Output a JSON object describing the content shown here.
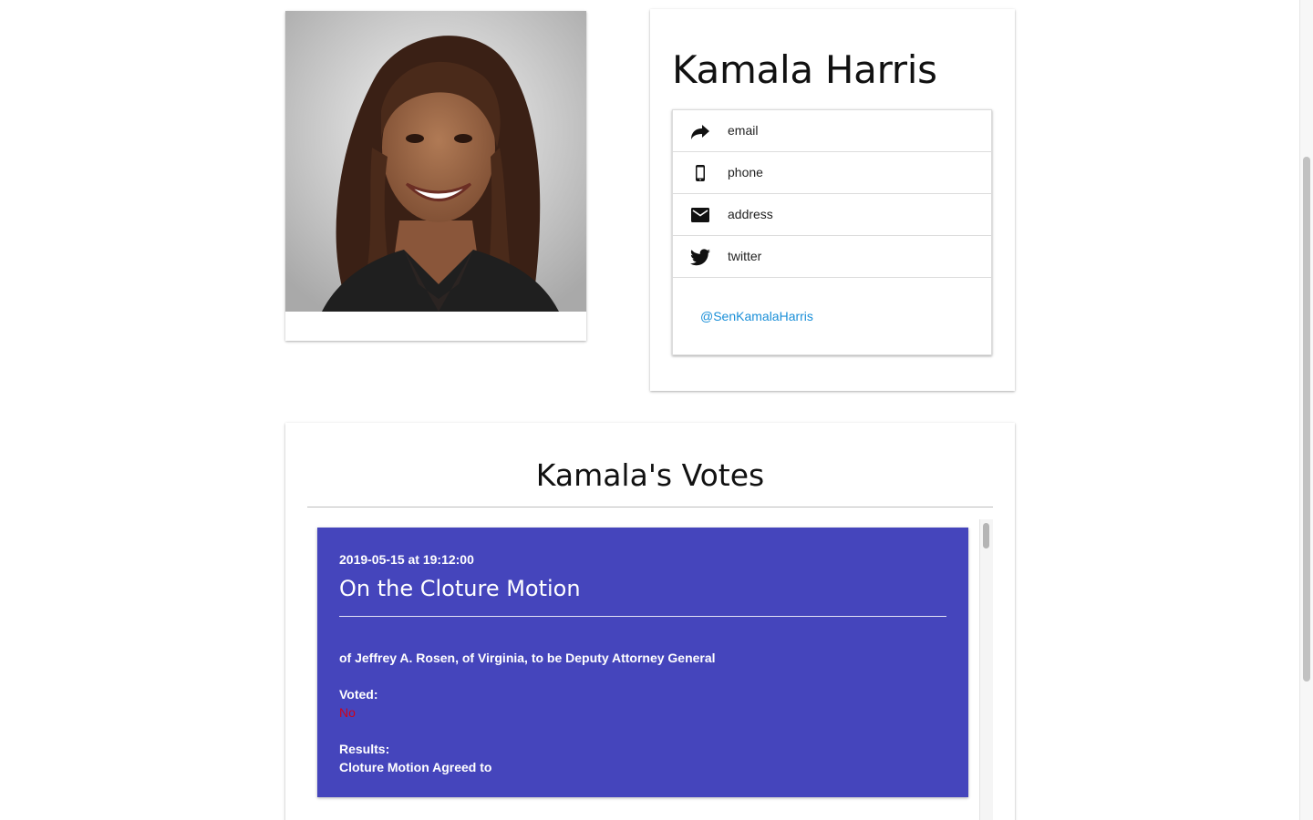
{
  "profile": {
    "name": "Kamala Harris",
    "photo_alt": "Kamala Harris portrait"
  },
  "contacts": [
    {
      "label": "email",
      "icon": "share-arrow-icon"
    },
    {
      "label": "phone",
      "icon": "phone-icon"
    },
    {
      "label": "address",
      "icon": "mail-envelope-icon"
    },
    {
      "label": "twitter",
      "icon": "twitter-bird-icon"
    }
  ],
  "twitter_handle": "@SenKamalaHarris",
  "votes": {
    "title": "Kamala's Votes",
    "items": [
      {
        "datetime": "2019-05-15 at 19:12:00",
        "question": "On the Cloture Motion",
        "description": "of Jeffrey A. Rosen, of Virginia, to be Deputy Attorney General",
        "voted_label": "Voted:",
        "voted_value": "No",
        "results_label": "Results:",
        "results_value": "Cloture Motion Agreed to"
      }
    ]
  },
  "colors": {
    "vote_card_bg": "#4545bc",
    "no_vote": "#d0021b",
    "link": "#1a8fd8"
  }
}
